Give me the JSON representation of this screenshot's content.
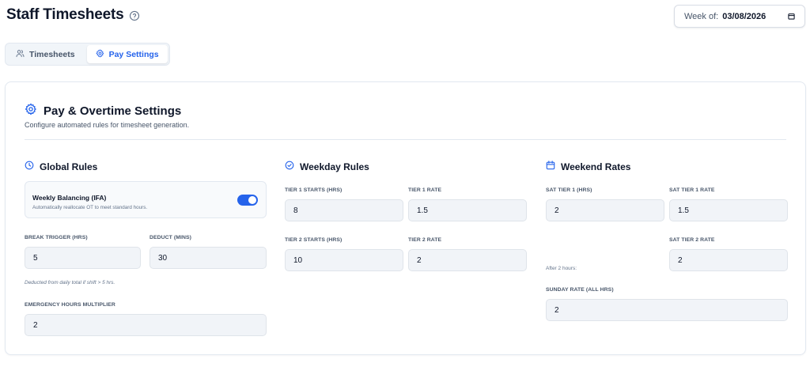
{
  "header": {
    "title": "Staff Timesheets",
    "week_label": "Week of:",
    "week_value": "03/08/2026"
  },
  "tabs": [
    {
      "label": "Timesheets",
      "icon": "users-icon",
      "active": false
    },
    {
      "label": "Pay Settings",
      "icon": "gear-icon",
      "active": true
    }
  ],
  "settings": {
    "title": "Pay & Overtime Settings",
    "subtitle": "Configure automated rules for timesheet generation.",
    "global": {
      "title": "Global Rules",
      "balancing": {
        "title": "Weekly Balancing (IFA)",
        "description": "Automatically reallocate OT to meet standard hours.",
        "enabled": true
      },
      "break_trigger": {
        "label": "Break Trigger (Hrs)",
        "value": "5"
      },
      "deduct": {
        "label": "Deduct (Mins)",
        "value": "30"
      },
      "break_note": "Deducted from daily total if shift > 5 hrs.",
      "emergency": {
        "label": "Emergency Hours Multiplier",
        "value": "2"
      }
    },
    "weekday": {
      "title": "Weekday Rules",
      "tier1_start": {
        "label": "Tier 1 Starts (Hrs)",
        "value": "8"
      },
      "tier1_rate": {
        "label": "Tier 1 Rate",
        "value": "1.5"
      },
      "tier2_start": {
        "label": "Tier 2 Starts (Hrs)",
        "value": "10"
      },
      "tier2_rate": {
        "label": "Tier 2 Rate",
        "value": "2"
      }
    },
    "weekend": {
      "title": "Weekend Rates",
      "sat_tier1": {
        "label": "Sat Tier 1 (Hrs)",
        "value": "2"
      },
      "sat_tier1_rate": {
        "label": "Sat Tier 1 Rate",
        "value": "1.5"
      },
      "sat_tier2_note": "After 2 hours:",
      "sat_tier2_rate": {
        "label": "Sat Tier 2 Rate",
        "value": "2"
      },
      "sunday_rate": {
        "label": "Sunday Rate (All Hrs)",
        "value": "2"
      }
    }
  },
  "colors": {
    "accent": "#2563eb",
    "input_bg": "#f1f4f8",
    "border": "#e2e8f0"
  }
}
